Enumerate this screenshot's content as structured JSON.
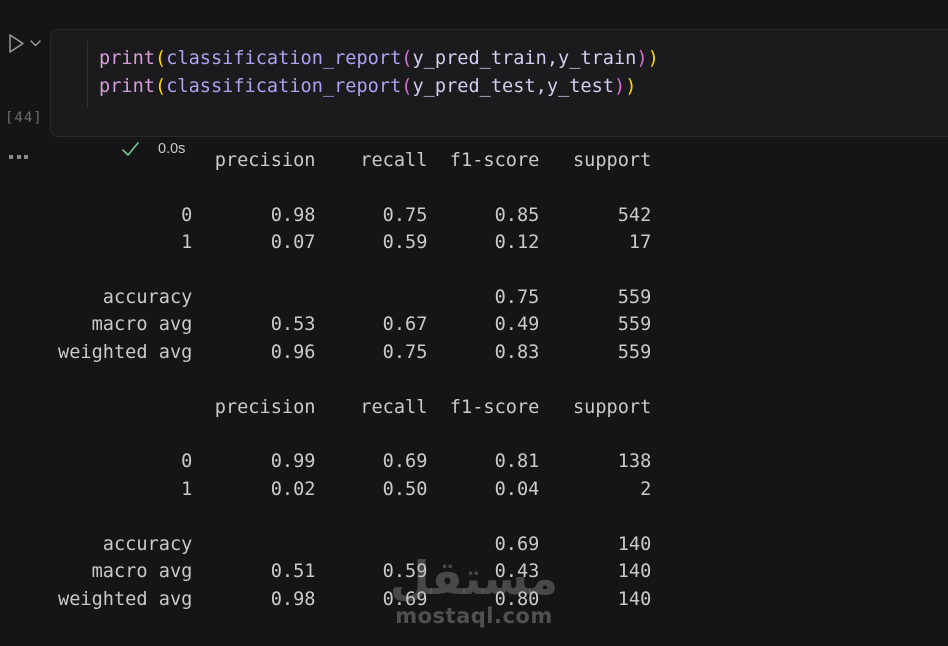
{
  "theme": {
    "page_bg": "#151517",
    "cell_bg": "#1b1b1d",
    "success_green": "#73c991",
    "icon_gray": "#a0a0a0",
    "output_text": "#cacaca",
    "token_colors": {
      "keyword": "#d79ddb",
      "function": "#b1a0f0",
      "bracket1": "#ffd602",
      "bracket2": "#d670d6",
      "variable": "#d5ccf0"
    }
  },
  "cell": {
    "execution_count": "[44]",
    "exec_time": "0.0s",
    "icons": [
      "run-icon",
      "chevron-down-icon",
      "check-icon",
      "ellipsis-icon"
    ],
    "code_lines": [
      {
        "tokens": [
          {
            "text": "print",
            "color": "keyword"
          },
          {
            "text": "(",
            "color": "bracket1"
          },
          {
            "text": "classification_report",
            "color": "function"
          },
          {
            "text": "(",
            "color": "bracket2"
          },
          {
            "text": "y_pred_train,y_train",
            "color": "variable"
          },
          {
            "text": ")",
            "color": "bracket2"
          },
          {
            "text": ")",
            "color": "bracket1"
          }
        ]
      },
      {
        "tokens": [
          {
            "text": "print",
            "color": "keyword"
          },
          {
            "text": "(",
            "color": "bracket1"
          },
          {
            "text": "classification_report",
            "color": "function"
          },
          {
            "text": "(",
            "color": "bracket2"
          },
          {
            "text": "y_pred_test,y_test",
            "color": "variable"
          },
          {
            "text": ")",
            "color": "bracket2"
          },
          {
            "text": ")",
            "color": "bracket1"
          }
        ]
      }
    ]
  },
  "output": {
    "reports": [
      {
        "headers": [
          "precision",
          "recall",
          "f1-score",
          "support"
        ],
        "class_rows": [
          {
            "label": "0",
            "precision": "0.98",
            "recall": "0.75",
            "f1": "0.85",
            "support": "542"
          },
          {
            "label": "1",
            "precision": "0.07",
            "recall": "0.59",
            "f1": "0.12",
            "support": "17"
          }
        ],
        "accuracy_row": {
          "label": "accuracy",
          "f1": "0.75",
          "support": "559"
        },
        "avg_rows": [
          {
            "label": "macro avg",
            "precision": "0.53",
            "recall": "0.67",
            "f1": "0.49",
            "support": "559"
          },
          {
            "label": "weighted avg",
            "precision": "0.96",
            "recall": "0.75",
            "f1": "0.83",
            "support": "559"
          }
        ]
      },
      {
        "headers": [
          "precision",
          "recall",
          "f1-score",
          "support"
        ],
        "class_rows": [
          {
            "label": "0",
            "precision": "0.99",
            "recall": "0.69",
            "f1": "0.81",
            "support": "138"
          },
          {
            "label": "1",
            "precision": "0.02",
            "recall": "0.50",
            "f1": "0.04",
            "support": "2"
          }
        ],
        "accuracy_row": {
          "label": "accuracy",
          "f1": "0.69",
          "support": "140"
        },
        "avg_rows": [
          {
            "label": "macro avg",
            "precision": "0.51",
            "recall": "0.59",
            "f1": "0.43",
            "support": "140"
          },
          {
            "label": "weighted avg",
            "precision": "0.98",
            "recall": "0.69",
            "f1": "0.80",
            "support": "140"
          }
        ]
      }
    ]
  },
  "watermark": {
    "arabic": "مستقل",
    "domain": "mostaql.com"
  }
}
